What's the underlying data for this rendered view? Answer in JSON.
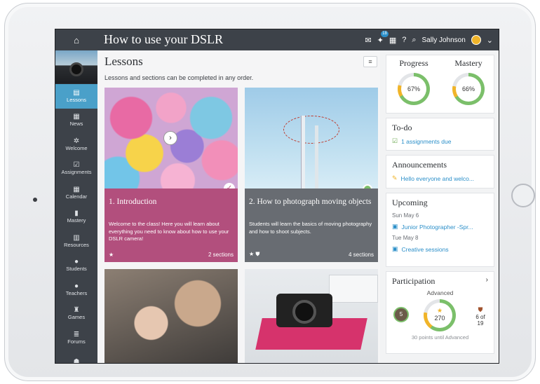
{
  "app": {
    "title": "How to use your DSLR"
  },
  "topbar": {
    "notifications_badge": "18",
    "user_name": "Sally Johnson"
  },
  "sidebar": {
    "items": [
      {
        "label": "Lessons",
        "icon": "lessons-icon",
        "glyph": "▤",
        "active": true
      },
      {
        "label": "News",
        "icon": "news-icon",
        "glyph": "▦"
      },
      {
        "label": "Welcome",
        "icon": "welcome-icon",
        "glyph": "✲"
      },
      {
        "label": "Assignments",
        "icon": "assignments-icon",
        "glyph": "☑"
      },
      {
        "label": "Calendar",
        "icon": "calendar-icon",
        "glyph": "▦"
      },
      {
        "label": "Mastery",
        "icon": "mastery-icon",
        "glyph": "▮"
      },
      {
        "label": "Resources",
        "icon": "resources-icon",
        "glyph": "▥"
      },
      {
        "label": "Students",
        "icon": "students-icon",
        "glyph": "●"
      },
      {
        "label": "Teachers",
        "icon": "teachers-icon",
        "glyph": "●"
      },
      {
        "label": "Games",
        "icon": "games-icon",
        "glyph": "♜"
      },
      {
        "label": "Forums",
        "icon": "forums-icon",
        "glyph": "≣"
      },
      {
        "label": "",
        "icon": "groups-icon",
        "glyph": "☗"
      }
    ]
  },
  "main": {
    "heading": "Lessons",
    "subtitle": "Lessons and sections can be completed in any order.",
    "cards": [
      {
        "title": "1. Introduction",
        "description": "Welcome to the class! Here you will learn about everything you need to know about how to use your DSLR camera!",
        "sections": "2 sections",
        "color": "#b24f7d"
      },
      {
        "title": "2. How to photograph moving objects",
        "description": "Students will learn the basics of moving photography and how to shoot subjects.",
        "sections": "4 sections",
        "color": "#686c72"
      }
    ]
  },
  "right": {
    "progress": {
      "label": "Progress",
      "value": "67%",
      "fraction": 0.67
    },
    "mastery": {
      "label": "Mastery",
      "value": "66%",
      "fraction": 0.66
    },
    "todo": {
      "title": "To-do",
      "item": "1 assignments due"
    },
    "announcements": {
      "title": "Announcements",
      "item": "Hello everyone and welco..."
    },
    "upcoming": {
      "title": "Upcoming",
      "date1": "Sun May 6",
      "event1": "Junior Photographer -Spr...",
      "date2": "Tue May 8",
      "event2": "Creative sessions"
    },
    "participation": {
      "title": "Participation",
      "level": "Advanced",
      "points": "270",
      "badge": "5",
      "rank": "6 of 19",
      "note": "30 points until Advanced"
    }
  },
  "colors": {
    "accent": "#4aa0c9",
    "bar": "#3d4249",
    "link": "#2b8fc9",
    "green": "#7bbf6a",
    "gold": "#f0b429"
  }
}
